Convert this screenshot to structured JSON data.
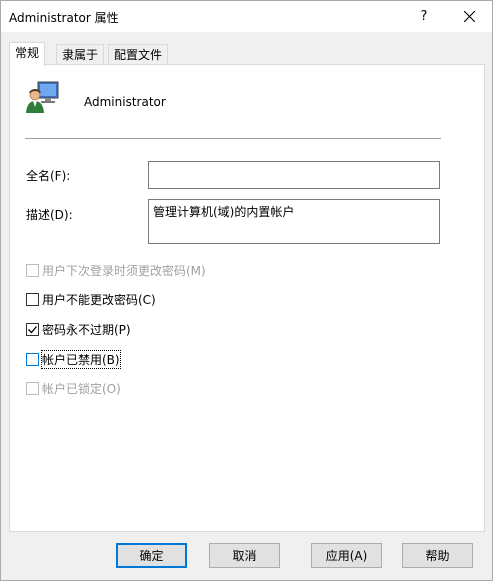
{
  "window": {
    "title": "Administrator 属性",
    "help_glyph": "?"
  },
  "tabs": [
    {
      "label": "常规",
      "active": true
    },
    {
      "label": "隶属于",
      "active": false
    },
    {
      "label": "配置文件",
      "active": false
    }
  ],
  "user": {
    "name": "Administrator",
    "icon": "user-monitor-icon"
  },
  "fields": {
    "fullname_label": "全名(F):",
    "fullname_value": "",
    "description_label": "描述(D):",
    "description_value": "管理计算机(域)的内置帐户"
  },
  "checkboxes": [
    {
      "label": "用户下次登录时须更改密码(M)",
      "checked": false,
      "enabled": false
    },
    {
      "label": "用户不能更改密码(C)",
      "checked": false,
      "enabled": true
    },
    {
      "label": "密码永不过期(P)",
      "checked": true,
      "enabled": true
    },
    {
      "label": "帐户已禁用(B)",
      "checked": false,
      "enabled": true,
      "focused": true
    },
    {
      "label": "帐户已锁定(O)",
      "checked": false,
      "enabled": false
    }
  ],
  "buttons": {
    "ok": "确定",
    "cancel": "取消",
    "apply": "应用(A)",
    "help": "帮助"
  },
  "colors": {
    "accent": "#0078d7",
    "disabled_text": "#a0a0a0"
  }
}
